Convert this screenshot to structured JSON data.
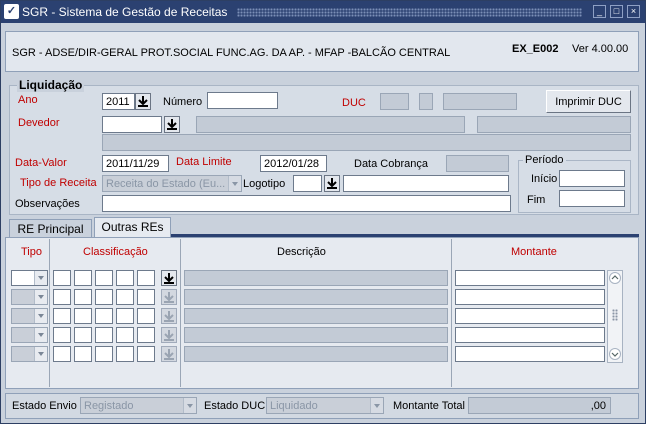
{
  "window": {
    "title": "SGR - Sistema de Gestão de Receitas"
  },
  "header": {
    "org": "SGR - ADSE/DIR-GERAL PROT.SOCIAL FUNC.AG. DA AP. - MFAP -BALCÃO CENTRAL",
    "code": "EX_E002",
    "version": "Ver 4.00.00"
  },
  "liquidacao": {
    "section_title": "Liquidação",
    "ano_label": "Ano",
    "ano_value": "2011",
    "numero_label": "Número",
    "numero_value": "",
    "duc_label": "DUC",
    "imprimir_label": "Imprimir DUC",
    "devedor_label": "Devedor",
    "devedor_value": "",
    "data_valor_label": "Data-Valor",
    "data_valor_value": "2011/11/29",
    "data_limite_label": "Data Limite",
    "data_limite_value": "2012/01/28",
    "data_cobranca_label": "Data Cobrança",
    "periodo_label": "Período",
    "inicio_label": "Início",
    "fim_label": "Fim",
    "tipo_receita_label": "Tipo de Receita",
    "tipo_receita_value": "Receita do Estado (Eu...",
    "logotipo_label": "Logotipo",
    "observacoes_label": "Observações"
  },
  "tabs": [
    {
      "label": "RE Principal",
      "active": false
    },
    {
      "label": "Outras REs",
      "active": true
    }
  ],
  "grid": {
    "headers": {
      "tipo": "Tipo",
      "classificacao": "Classificação",
      "descricao": "Descrição",
      "montante": "Montante"
    },
    "row_count": 5
  },
  "footer": {
    "estado_envio_label": "Estado Envio",
    "estado_envio_value": "Registado",
    "estado_duc_label": "Estado DUC",
    "estado_duc_value": "Liquidado",
    "montante_total_label": "Montante Total",
    "montante_total_value": ",00"
  },
  "icons": {
    "app": "app-icon",
    "lov": "down-arrow-list-icon",
    "minimize": "minimize-icon",
    "maximize": "maximize-icon",
    "close": "close-icon"
  },
  "colors": {
    "titlebar": "#2b4171",
    "label_red": "#c00000",
    "background": "#c9d1dc"
  }
}
